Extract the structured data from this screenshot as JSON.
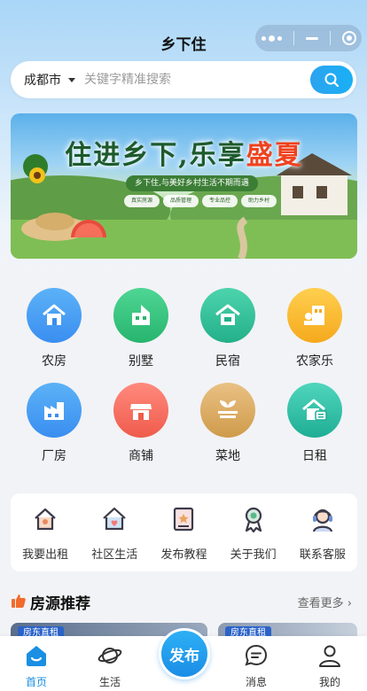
{
  "header": {
    "title": "乡下住"
  },
  "search": {
    "city": "成都市",
    "placeholder": "关键字精准搜索"
  },
  "banner": {
    "title_main": "住进乡下,乐享",
    "title_highlight": "盛夏",
    "subtitle": "乡下住,与美好乡村生活不期而遇",
    "features": [
      "真实房源",
      "品质管理",
      "专业品控",
      "助力乡村"
    ]
  },
  "categories": [
    {
      "label": "农房",
      "icon": "house-icon",
      "color": "#3f9bf0"
    },
    {
      "label": "别墅",
      "icon": "villa-icon",
      "color": "#31c27c"
    },
    {
      "label": "民宿",
      "icon": "homestay-icon",
      "color": "#2fbf8f"
    },
    {
      "label": "农家乐",
      "icon": "farmhouse-icon",
      "color": "#f7b52a"
    },
    {
      "label": "厂房",
      "icon": "factory-icon",
      "color": "#3f9bf0"
    },
    {
      "label": "商铺",
      "icon": "shop-icon",
      "color": "#f46a5d"
    },
    {
      "label": "菜地",
      "icon": "farmland-icon",
      "color": "#d9a85a"
    },
    {
      "label": "日租",
      "icon": "daily-rent-icon",
      "color": "#2fbfa4"
    }
  ],
  "services": [
    {
      "label": "我要出租",
      "icon": "rent-out-icon"
    },
    {
      "label": "社区生活",
      "icon": "community-icon"
    },
    {
      "label": "发布教程",
      "icon": "tutorial-icon"
    },
    {
      "label": "关于我们",
      "icon": "about-icon"
    },
    {
      "label": "联系客服",
      "icon": "customer-service-icon"
    }
  ],
  "recommend": {
    "title": "房源推荐",
    "more": "查看更多",
    "card_tags": [
      "房东直租",
      "房东直租"
    ]
  },
  "tabbar": {
    "items": [
      {
        "label": "首页",
        "icon": "home-icon",
        "active": true
      },
      {
        "label": "生活",
        "icon": "planet-icon",
        "active": false
      },
      {
        "label": "消息",
        "icon": "message-icon",
        "active": false
      },
      {
        "label": "我的",
        "icon": "user-icon",
        "active": false
      }
    ],
    "publish_label": "发布"
  },
  "colors": {
    "accent": "#1a8fe3",
    "brand_blue": "#19b0f5"
  }
}
